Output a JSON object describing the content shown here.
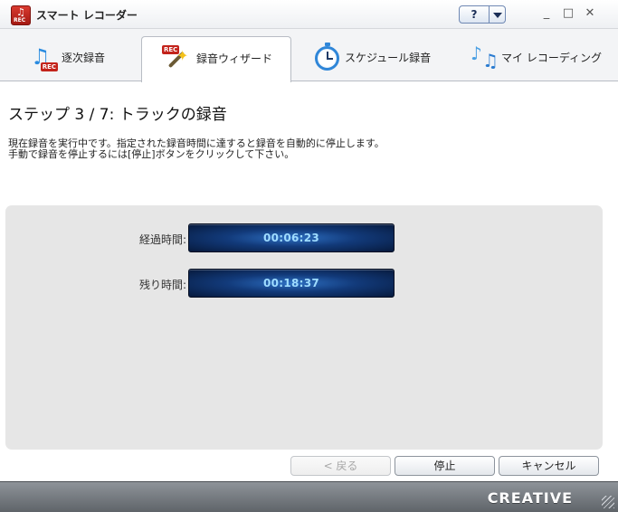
{
  "window": {
    "title": "スマート レコーダー",
    "help_label": "?",
    "minimize": "_",
    "maximize": "□",
    "close": "✕"
  },
  "tabs": [
    {
      "label": "逐次録音",
      "icon": "music-rec-icon",
      "active": false
    },
    {
      "label": "録音ウィザード",
      "icon": "wizard-wand-icon",
      "active": true
    },
    {
      "label": "スケジュール録音",
      "icon": "clock-icon",
      "active": false
    },
    {
      "label": "マイ レコーディング",
      "icon": "music-notes-icon",
      "active": false
    }
  ],
  "main": {
    "step_title": "ステップ 3 / 7: トラックの録音",
    "description_line1": "現在録音を実行中です。指定された録音時間に達すると録音を自動的に停止します。",
    "description_line2": "手動で録音を停止するには[停止]ボタンをクリックして下さい。",
    "elapsed_label": "経過時間:",
    "elapsed_value": "00:06:23",
    "remaining_label": "残り時間:",
    "remaining_value": "00:18:37"
  },
  "buttons": {
    "back": "< 戻る",
    "stop": "停止",
    "cancel": "キャンセル"
  },
  "footer": {
    "brand": "CREATIVE"
  },
  "colors": {
    "timer_text": "#9fdcff",
    "timer_bg": "#123a7a",
    "panel_bg": "#e6e6e6"
  }
}
